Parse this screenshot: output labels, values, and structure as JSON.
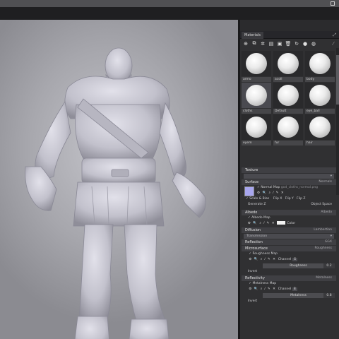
{
  "window": {
    "controls": [
      "minimize",
      "maximize",
      "close"
    ]
  },
  "panel": {
    "tab_label": "Materials",
    "toolbar_icons": [
      "add-icon",
      "duplicate-icon",
      "settings-icon",
      "import-icon",
      "folder-icon",
      "delete-icon",
      "sync-icon",
      "sphere-icon",
      "palette-icon",
      "pin-icon"
    ],
    "materials": [
      {
        "name": "armo"
      },
      {
        "name": "acoll"
      },
      {
        "name": "body"
      },
      {
        "name": "cloths",
        "selected": true
      },
      {
        "name": "Default"
      },
      {
        "name": "eye_ball"
      },
      {
        "name": "eyem"
      },
      {
        "name": "fur"
      },
      {
        "name": "hair"
      }
    ]
  },
  "properties": {
    "texture_header": "Texture",
    "texture_dropdown": "",
    "surface": {
      "header": "Surface",
      "value": "Normals"
    },
    "normal_map": {
      "label": "Normal Map",
      "file": "god_cloths_normal.png"
    },
    "surface_opts": [
      "Scale & Bias",
      "Flip X",
      "Flip Y",
      "Flip Z"
    ],
    "generate_z": "Generate Z",
    "object_space": "Object Space",
    "albedo": {
      "header": "Albedo",
      "value": "Albedo",
      "map_label": "Albedo Map",
      "color_label": "Color"
    },
    "diffusion": {
      "header": "Diffusion",
      "value": "Lambertian",
      "dropdown": "Transmission"
    },
    "reflection": {
      "header": "Reflection",
      "value": "GGX"
    },
    "microsurface": {
      "header": "Microsurface",
      "value": "Roughness",
      "map_label": "Roughness Map",
      "channel_label": "Channel",
      "channel_value": "G",
      "slider_label": "Roughness",
      "slider_value": "0.2",
      "invert": "Invert"
    },
    "reflectivity": {
      "header": "Reflectivity",
      "value": "Metalness",
      "map_label": "Metalness Map",
      "channel_label": "Channel",
      "channel_value": "B",
      "slider_label": "Metalness",
      "slider_value": "0.8",
      "invert": "Invert"
    }
  },
  "colors": {
    "accent_swatch": "#a8a6ee",
    "panel_bg": "#303032",
    "viewport_bg": "#a9a9af"
  }
}
